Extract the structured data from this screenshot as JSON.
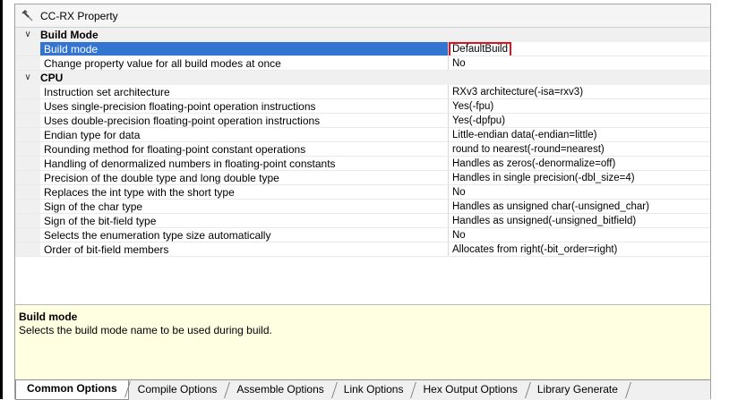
{
  "window": {
    "title": "CC-RX Property"
  },
  "categories": [
    {
      "name": "Build Mode",
      "rows": [
        {
          "label": "Build mode",
          "value": "DefaultBuild",
          "selected": true
        },
        {
          "label": "Change property value for all build modes at once",
          "value": "No"
        }
      ]
    },
    {
      "name": "CPU",
      "rows": [
        {
          "label": "Instruction set architecture",
          "value": "RXv3 architecture(-isa=rxv3)"
        },
        {
          "label": "Uses single-precision floating-point operation instructions",
          "value": "Yes(-fpu)"
        },
        {
          "label": "Uses double-precision floating-point operation instructions",
          "value": "Yes(-dpfpu)"
        },
        {
          "label": "Endian type for data",
          "value": "Little-endian data(-endian=little)"
        },
        {
          "label": "Rounding method for floating-point constant operations",
          "value": "round to nearest(-round=nearest)"
        },
        {
          "label": "Handling of denormalized numbers in floating-point constants",
          "value": "Handles as zeros(-denormalize=off)"
        },
        {
          "label": "Precision of the double type and long double type",
          "value": "Handles in single precision(-dbl_size=4)"
        },
        {
          "label": "Replaces the int type with the short type",
          "value": "No"
        },
        {
          "label": "Sign of the char type",
          "value": "Handles as unsigned char(-unsigned_char)"
        },
        {
          "label": "Sign of the bit-field type",
          "value": "Handles as unsigned(-unsigned_bitfield)"
        },
        {
          "label": "Selects the enumeration type size automatically",
          "value": "No"
        },
        {
          "label": "Order of bit-field members",
          "value": "Allocates from right(-bit_order=right)"
        }
      ]
    }
  ],
  "description": {
    "title": "Build mode",
    "text": "Selects the build mode name to be used during build."
  },
  "tabs": [
    {
      "label": "Common Options",
      "active": true
    },
    {
      "label": "Compile Options",
      "active": false
    },
    {
      "label": "Assemble Options",
      "active": false
    },
    {
      "label": "Link Options",
      "active": false
    },
    {
      "label": "Hex Output Options",
      "active": false
    },
    {
      "label": "Library Generate",
      "active": false
    }
  ],
  "colors": {
    "selection": "#3374d0",
    "highlight_box": "#e0141e",
    "description_bg": "#ffffe1"
  }
}
